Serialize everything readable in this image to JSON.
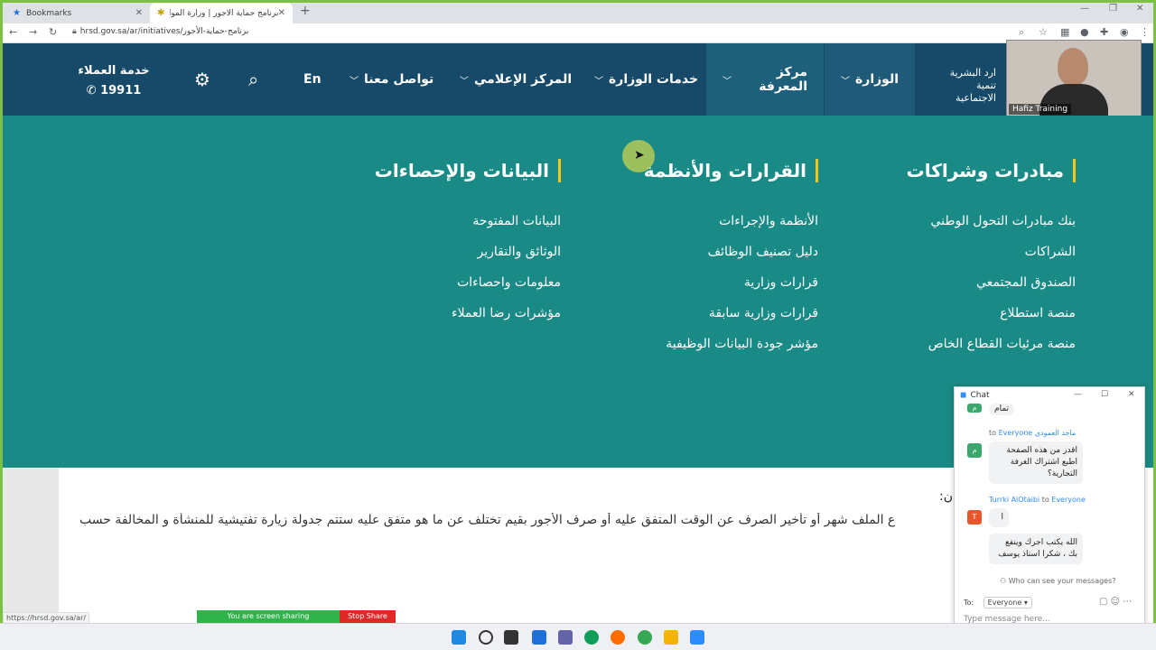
{
  "browser": {
    "tabs": [
      {
        "label": "Bookmarks"
      },
      {
        "label": "برنامج حماية الأجور | وزارة الموارد ال"
      }
    ],
    "url": "hrsd.gov.sa/ar/initiatives/برنامج-حماية-الأجور",
    "status_url": "https://hrsd.gov.sa/ar/"
  },
  "header": {
    "brand_line1": "ارد البشرية",
    "brand_line2": "تنمية الاجتماعية",
    "nav": [
      {
        "label": "الوزارة"
      },
      {
        "label": "مركز المعرفة"
      },
      {
        "label": "خدمات الوزارة"
      },
      {
        "label": "المركز الإعلامي"
      },
      {
        "label": "تواصل معنا"
      }
    ],
    "lang": "En",
    "customer_service_label": "خدمة العملاء",
    "customer_service_number": "19911"
  },
  "webcam": {
    "name": "Hafiz Training"
  },
  "mega_menu": {
    "columns": [
      {
        "title": "مبادرات وشراكات",
        "items": [
          "بنك مبادرات التحول الوطني",
          "الشراكات",
          "الصندوق المجتمعي",
          "منصة استطلاع",
          "منصة مرئيات القطاع الخاص"
        ]
      },
      {
        "title": "القرارات والأنظمة",
        "items": [
          "الأنظمة والإجراءات",
          "دليل تصنيف الوظائف",
          "قرارات وزارية",
          "قرارات وزارية سابقة",
          "مؤشر جودة البيانات الوظيفية"
        ]
      },
      {
        "title": "البيانات والإحصاءات",
        "items": [
          "البيانات المفتوحة",
          "الوثائق والتقارير",
          "معلومات واحصاءات",
          "مؤشرات رضا العملاء"
        ]
      }
    ]
  },
  "content": {
    "label": ":ن",
    "paragraph": "ع الملف شهر أو تأخير الصرف عن الوقت المتفق عليه أو صرف الأجور بقيم تختلف عن ما هو متفق عليه ستتم جدولة زيارة تفتيشية للمنشأة و المخالفة حسب"
  },
  "chat": {
    "title": "Chat",
    "messages": [
      {
        "sender": "",
        "to": "",
        "avatar": "م",
        "avatar_color": "#3aa76d",
        "text": "تمام"
      },
      {
        "sender": "ماجد العمودي",
        "to": "Everyone",
        "avatar": "م",
        "avatar_color": "#3aa76d",
        "text": "اقدر من هذه الصفحة اطبع اشتراك الغرفة التجارية؟"
      },
      {
        "sender": "Turrki AlOtaibi",
        "to": "Everyone",
        "avatar": "T",
        "avatar_color": "#e8572a",
        "text": "ا"
      },
      {
        "sender": "",
        "to": "",
        "avatar": "",
        "avatar_color": "",
        "text": "الله يكتب اجرك وينفع بك ، شكرا استاذ يوسف"
      }
    ],
    "to_label": "To:",
    "to_value": "Everyone",
    "who_can_see": "Who can see your messages?",
    "input_placeholder": "Type message here..."
  },
  "share_bar": {
    "sharing": "You are screen sharing",
    "stop": "Stop Share"
  },
  "colors": {
    "header_bg": "#174a68",
    "mega_bg": "#1a8a86",
    "accent_bar": "#f5c518"
  }
}
